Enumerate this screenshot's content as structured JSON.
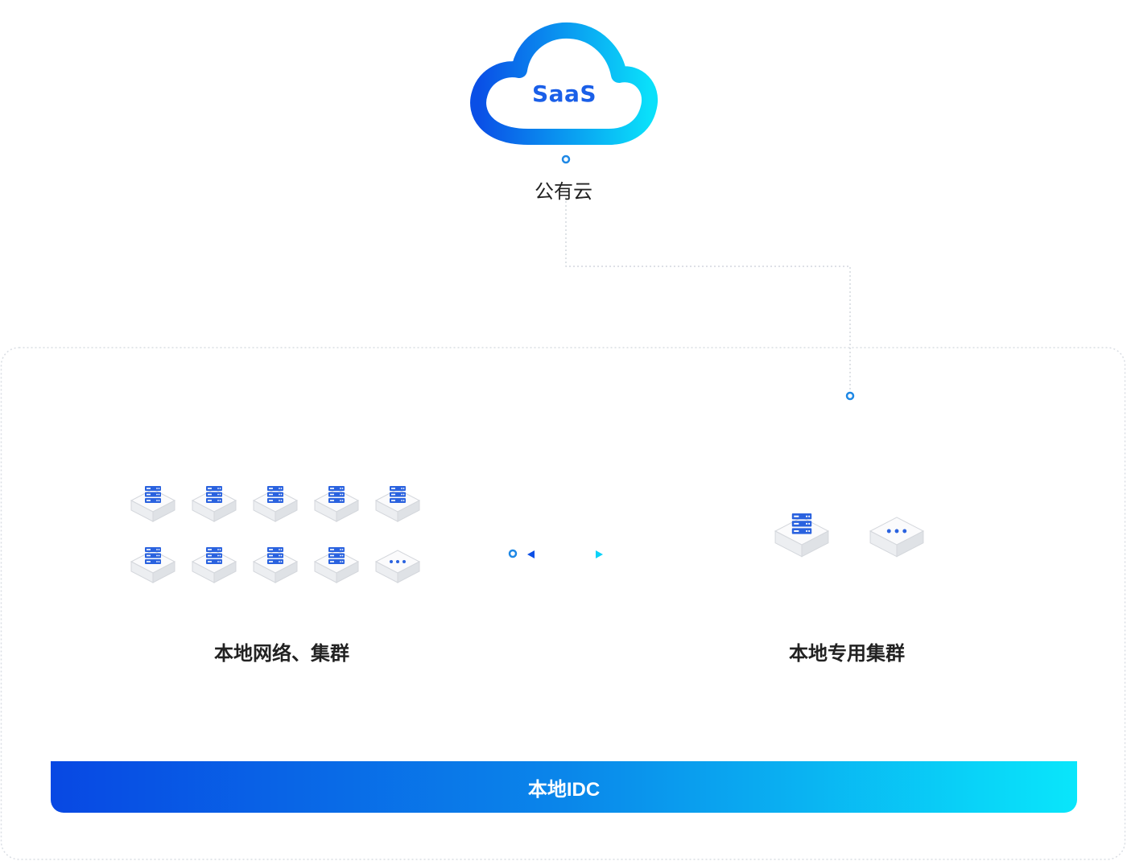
{
  "cloud": {
    "title": "SaaS",
    "label": "公有云"
  },
  "local_group": {
    "label": "本地网络、集群",
    "server_count": 9,
    "more_count": 1
  },
  "dedicated_group": {
    "label": "本地专用集群",
    "server_count": 1,
    "more_count": 1
  },
  "idc_bar": {
    "label": "本地IDC"
  },
  "colors": {
    "gradient_start": "#0848e3",
    "gradient_end": "#09e6fb",
    "server_blue": "#2a62df",
    "connector_blue": "#1e88e5"
  }
}
